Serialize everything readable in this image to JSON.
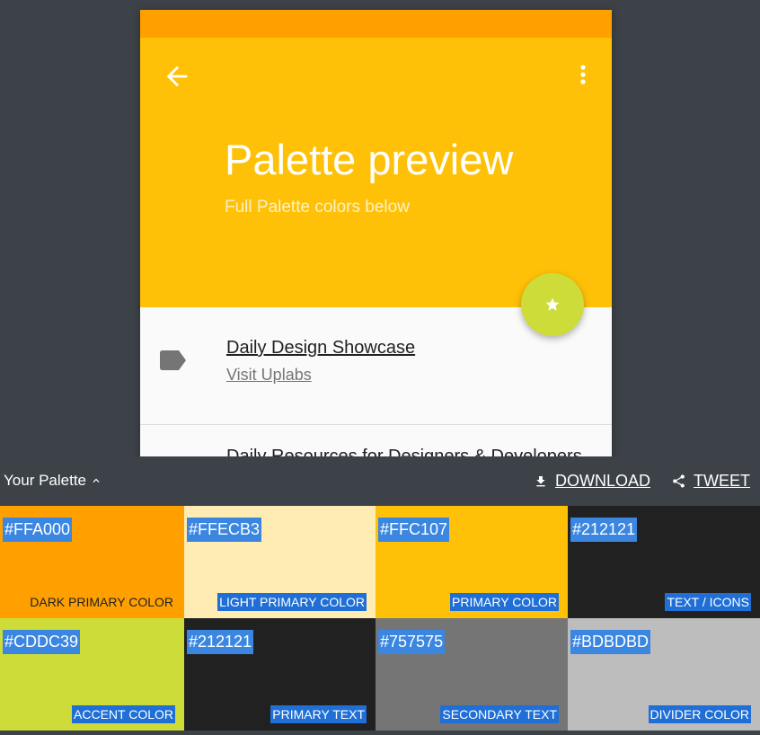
{
  "app": {
    "title": "Palette preview",
    "subtitle": "Full Palette colors below",
    "back_icon": "arrow-back-icon",
    "menu_icon": "more-vert-icon",
    "fab_icon": "star-icon"
  },
  "list": {
    "items": [
      {
        "title": "Daily Design Showcase",
        "link": "Visit Uplabs",
        "icon": "label-icon"
      },
      {
        "title": "Daily Resources for Designers & Developers",
        "icon": "circle-icon"
      }
    ]
  },
  "palette_bar": {
    "toggle_label": "Your Palette",
    "download_label": "DOWNLOAD",
    "tweet_label": "TWEET"
  },
  "swatches": [
    {
      "hex": "#FFA000",
      "name": "DARK PRIMARY COLOR",
      "color": "#FFA000"
    },
    {
      "hex": "#FFECB3",
      "name": "LIGHT PRIMARY COLOR",
      "color": "#FFECB3"
    },
    {
      "hex": "#FFC107",
      "name": "PRIMARY COLOR",
      "color": "#FFC107"
    },
    {
      "hex": "#212121",
      "name": "TEXT / ICONS",
      "color": "#212121"
    },
    {
      "hex": "#CDDC39",
      "name": "ACCENT COLOR",
      "color": "#CDDC39"
    },
    {
      "hex": "#212121",
      "name": "PRIMARY TEXT",
      "color": "#212121"
    },
    {
      "hex": "#757575",
      "name": "SECONDARY TEXT",
      "color": "#757575"
    },
    {
      "hex": "#BDBDBD",
      "name": "DIVIDER COLOR",
      "color": "#BDBDBD"
    }
  ],
  "colors": {
    "page_background": "#3c4248",
    "status_bar": "#FFA000",
    "header": "#FFC107",
    "fab": "#CDDC39",
    "label_highlight": "#3b86e0"
  }
}
